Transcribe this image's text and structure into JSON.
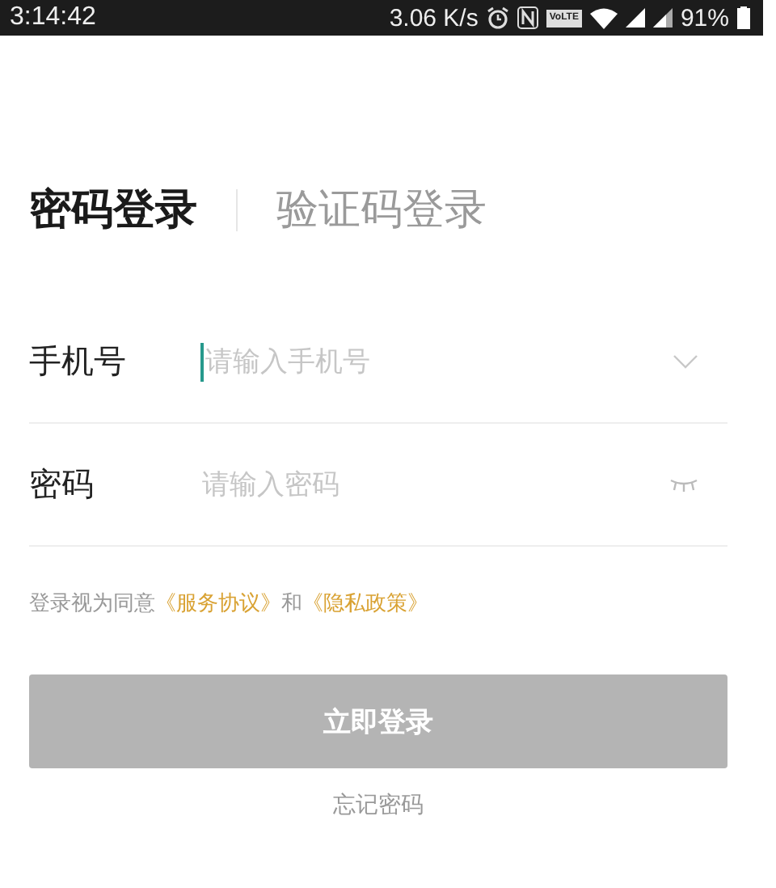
{
  "status_bar": {
    "time": "3:14:42",
    "speed": "3.06 K/s",
    "volte": "VoLTE",
    "battery": "91%"
  },
  "tabs": [
    {
      "label": "密码登录",
      "selected": true
    },
    {
      "label": "验证码登录",
      "selected": false
    }
  ],
  "fields": [
    {
      "kind": "phone",
      "label": "手机号",
      "placeholder": "请输入手机号",
      "focused": true
    },
    {
      "kind": "password",
      "label": "密码",
      "placeholder": "请输入密码",
      "focused": false
    }
  ],
  "agreement": [
    {
      "kind": "text",
      "text": "登录视为同意"
    },
    {
      "kind": "link",
      "text": "《服务协议》"
    },
    {
      "kind": "text",
      "text": "和"
    },
    {
      "kind": "link",
      "text": "《隐私政策》"
    }
  ],
  "login_button": {
    "label": "立即登录",
    "disabled": true
  },
  "forgot_link": "忘记密码"
}
